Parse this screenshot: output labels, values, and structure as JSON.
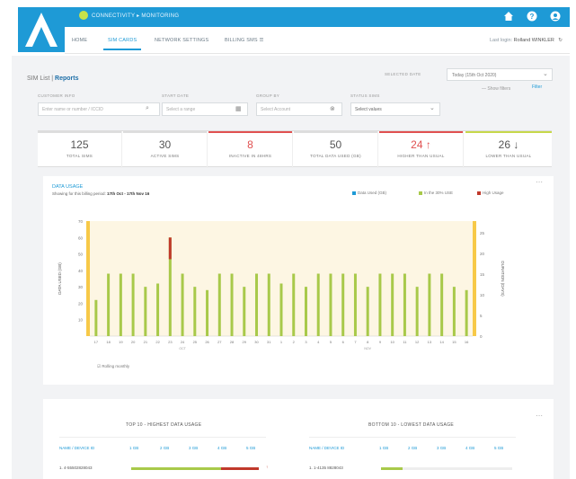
{
  "header": {
    "brand": "CONNECTIVITY ▸ MONITORING",
    "tabs": [
      {
        "label": "HOME"
      },
      {
        "label": "SIM CARDS"
      },
      {
        "label": "NETWORK SETTINGS"
      },
      {
        "label": "BILLING SMS ☰"
      }
    ],
    "user_label": "Last login:",
    "user_name": "Rolland WINKLER",
    "icons": [
      "home-icon",
      "help-icon",
      "user-icon"
    ]
  },
  "breadcrumb": {
    "parent": "SIM List",
    "sep": "|",
    "current": "Reports"
  },
  "filters": {
    "search_label": "CUSTOMER INFO",
    "search_placeholder": "Enter name or number / ICCID",
    "date_label": "START DATE",
    "date_placeholder": "Select a range",
    "group_label": "GROUP BY",
    "group_placeholder": "Select Account",
    "status_label": "STATUS SIMS",
    "status_value": "Select values",
    "period_label": "SELECTED DATE",
    "period_value": "Today (15th Oct 2020)",
    "show_more": "— Show filters",
    "filter_button": "Filter"
  },
  "stats": [
    {
      "value": "125",
      "label": "TOTAL SIMS",
      "color": "#dddddd"
    },
    {
      "value": "30",
      "label": "ACTIVE SIMS",
      "color": "#dddddd"
    },
    {
      "value": "8",
      "label": "INACTIVE IN 48HRS",
      "color": "#e05050"
    },
    {
      "value": "50",
      "label": "TOTAL DATA USED (GB)",
      "color": "#dddddd"
    },
    {
      "value": "24 ↑",
      "label": "HIGHER THAN USUAL",
      "color": "#e05050"
    },
    {
      "value": "26 ↓",
      "label": "LOWER THAN USUAL",
      "color": "#c7d84a"
    }
  ],
  "data_usage": {
    "title": "DATA USAGE",
    "subtitle_prefix": "Showing for this billing period: ",
    "subtitle_range": "17th Oct - 17th Nov 16",
    "legend": [
      {
        "name": "Data Used (GB)",
        "color": "#1e9ad6"
      },
      {
        "name": "In the 30% USE",
        "color": "#a8c94a"
      },
      {
        "name": "High Usage",
        "color": "#c0392b"
      }
    ],
    "rolling": "Rolling monthly"
  },
  "chart_data": {
    "type": "bar",
    "ylabel": "DATA USED (GB)",
    "y2label": "DURATION (DAYS)",
    "ylim": [
      0,
      100
    ],
    "yticks": [
      10,
      20,
      30,
      40,
      50,
      60,
      70
    ],
    "y2ticks": [
      0,
      5,
      10,
      15,
      20,
      25
    ],
    "categories": [
      "17",
      "18",
      "19",
      "20",
      "21",
      "22",
      "23",
      "24",
      "25",
      "26",
      "27",
      "28",
      "29",
      "30",
      "31",
      "1",
      "2",
      "3",
      "4",
      "5",
      "6",
      "7",
      "8",
      "9",
      "10",
      "11",
      "12",
      "13",
      "14",
      "15",
      "16"
    ],
    "values": [
      22,
      38,
      38,
      38,
      30,
      32,
      60,
      38,
      30,
      28,
      38,
      38,
      30,
      38,
      38,
      32,
      38,
      30,
      38,
      38,
      38,
      38,
      30,
      38,
      38,
      38,
      30,
      38,
      38,
      30,
      28
    ],
    "high_index": 6,
    "month_labels": [
      "OCT",
      "NOV"
    ],
    "grid": false,
    "legend_position": "top-right"
  },
  "lower": {
    "left_title": "TOP 10 - HIGHEST DATA USAGE",
    "right_title": "BOTTOM 10 - LOWEST DATA USAGE",
    "left_col": "NAME / DEVICE ID",
    "right_col": "NAME / DEVICE ID",
    "scale": [
      "1 GB",
      "2 GB",
      "3 GB",
      "4 GB",
      "5 GB"
    ],
    "left_row": "1. 4-55502828043",
    "right_row": "1. 1-4135 8828043"
  }
}
